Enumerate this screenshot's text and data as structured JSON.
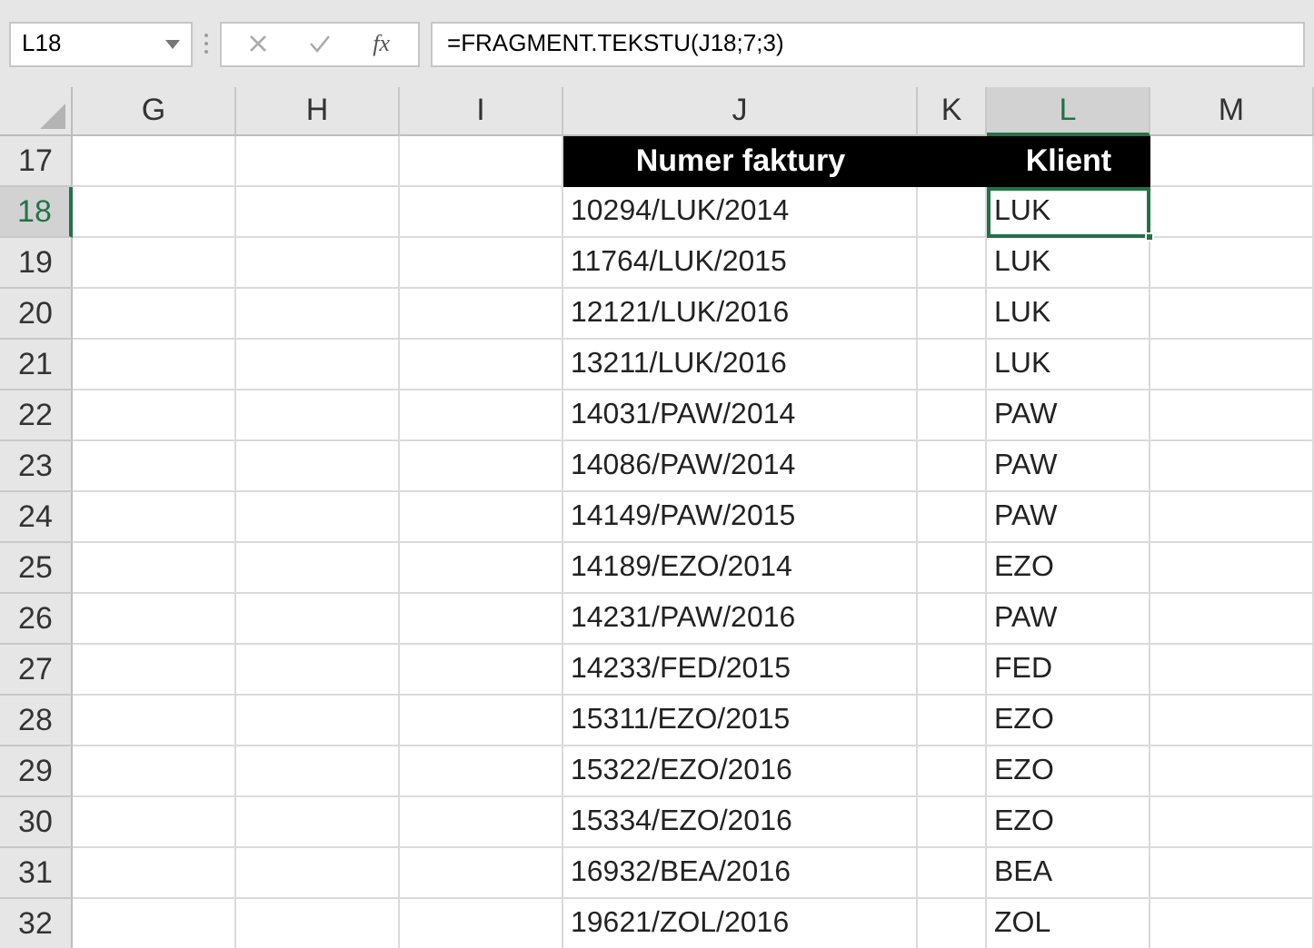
{
  "formula_bar": {
    "name_box": "L18",
    "function_label": "fx",
    "formula": "=FRAGMENT.TEKSTU(J18;7;3)"
  },
  "columns": [
    {
      "label": "G",
      "selected": false
    },
    {
      "label": "H",
      "selected": false
    },
    {
      "label": "I",
      "selected": false
    },
    {
      "label": "J",
      "selected": false
    },
    {
      "label": "K",
      "selected": false
    },
    {
      "label": "L",
      "selected": true
    },
    {
      "label": "M",
      "selected": false
    }
  ],
  "rows": [
    {
      "number": "17",
      "selected": false,
      "kind": "header",
      "invoice": "Numer faktury",
      "client": "Klient"
    },
    {
      "number": "18",
      "selected": true,
      "kind": "data",
      "invoice": "10294/LUK/2014",
      "client": "LUK"
    },
    {
      "number": "19",
      "selected": false,
      "kind": "data",
      "invoice": "11764/LUK/2015",
      "client": "LUK"
    },
    {
      "number": "20",
      "selected": false,
      "kind": "data",
      "invoice": "12121/LUK/2016",
      "client": "LUK"
    },
    {
      "number": "21",
      "selected": false,
      "kind": "data",
      "invoice": "13211/LUK/2016",
      "client": "LUK"
    },
    {
      "number": "22",
      "selected": false,
      "kind": "data",
      "invoice": "14031/PAW/2014",
      "client": "PAW"
    },
    {
      "number": "23",
      "selected": false,
      "kind": "data",
      "invoice": "14086/PAW/2014",
      "client": "PAW"
    },
    {
      "number": "24",
      "selected": false,
      "kind": "data",
      "invoice": "14149/PAW/2015",
      "client": "PAW"
    },
    {
      "number": "25",
      "selected": false,
      "kind": "data",
      "invoice": "14189/EZO/2014",
      "client": "EZO"
    },
    {
      "number": "26",
      "selected": false,
      "kind": "data",
      "invoice": "14231/PAW/2016",
      "client": "PAW"
    },
    {
      "number": "27",
      "selected": false,
      "kind": "data",
      "invoice": "14233/FED/2015",
      "client": "FED"
    },
    {
      "number": "28",
      "selected": false,
      "kind": "data",
      "invoice": "15311/EZO/2015",
      "client": "EZO"
    },
    {
      "number": "29",
      "selected": false,
      "kind": "data",
      "invoice": "15322/EZO/2016",
      "client": "EZO"
    },
    {
      "number": "30",
      "selected": false,
      "kind": "data",
      "invoice": "15334/EZO/2016",
      "client": "EZO"
    },
    {
      "number": "31",
      "selected": false,
      "kind": "data",
      "invoice": "16932/BEA/2016",
      "client": "BEA"
    },
    {
      "number": "32",
      "selected": false,
      "kind": "data",
      "invoice": "19621/ZOL/2016",
      "client": "ZOL"
    }
  ]
}
